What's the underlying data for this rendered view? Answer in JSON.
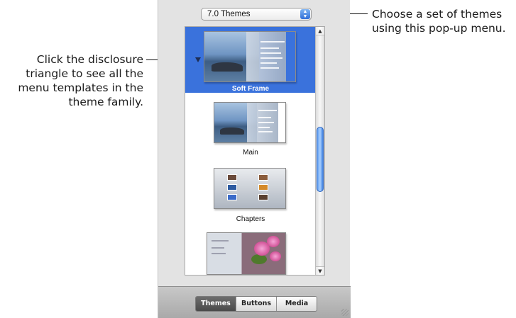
{
  "callouts": {
    "left": [
      "Click the disclosure",
      "triangle to see all the",
      "menu templates in the",
      "theme family."
    ],
    "right": [
      "Choose a set of themes",
      "using this pop-up menu."
    ]
  },
  "popup": {
    "selected": "7.0 Themes"
  },
  "themes": [
    {
      "label": "Soft Frame",
      "selected": true
    },
    {
      "label": "Main",
      "selected": false
    },
    {
      "label": "Chapters",
      "selected": false
    },
    {
      "label": "",
      "selected": false
    }
  ],
  "tabs": [
    {
      "label": "Themes",
      "active": true
    },
    {
      "label": "Buttons",
      "active": false
    },
    {
      "label": "Media",
      "active": false
    }
  ],
  "icons": {
    "disclosure": "disclosure-triangle-icon",
    "popup_arrows": "up-down-arrows-icon",
    "scroll_up": "scroll-up-arrow-icon",
    "scroll_down": "scroll-down-arrow-icon"
  },
  "colors": {
    "selection": "#3a72dc",
    "accent": "#2f6fd8"
  }
}
